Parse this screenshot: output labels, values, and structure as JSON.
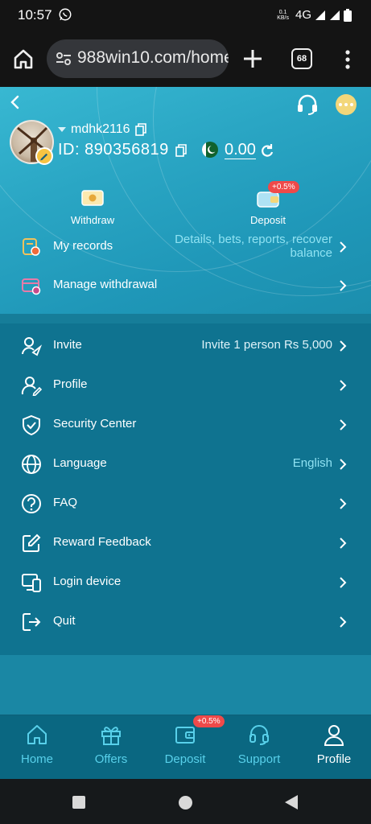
{
  "status_bar": {
    "time": "10:57",
    "speed_value": "0.1",
    "speed_unit": "KB/s",
    "network": "4G",
    "icons": [
      "whatsapp-icon",
      "signal-icon",
      "battery-icon"
    ]
  },
  "browser": {
    "url": "988win10.com/home",
    "tab_count": "68"
  },
  "header": {
    "username": "mdhk2116",
    "id_label": "ID: 890356819",
    "balance": "0.00"
  },
  "quick_actions": {
    "withdraw_label": "Withdraw",
    "deposit_label": "Deposit",
    "deposit_badge": "+0.5%"
  },
  "records": [
    {
      "label": "My records",
      "value_line1": "Details, bets, reports, recover",
      "value_line2": "balance"
    },
    {
      "label": "Manage withdrawal",
      "value_line1": "",
      "value_line2": ""
    }
  ],
  "menu": [
    {
      "label": "Invite",
      "value": "Invite 1 person Rs 5,000",
      "icon": "invite-icon"
    },
    {
      "label": "Profile",
      "value": "",
      "icon": "profile-icon"
    },
    {
      "label": "Security Center",
      "value": "",
      "icon": "shield-icon"
    },
    {
      "label": "Language",
      "value": "English",
      "icon": "globe-icon"
    },
    {
      "label": "FAQ",
      "value": "",
      "icon": "question-icon"
    },
    {
      "label": "Reward Feedback",
      "value": "",
      "icon": "edit-icon"
    },
    {
      "label": "Login device",
      "value": "",
      "icon": "devices-icon"
    },
    {
      "label": "Quit",
      "value": "",
      "icon": "logout-icon"
    }
  ],
  "bottom_nav": [
    {
      "label": "Home",
      "icon": "home-icon"
    },
    {
      "label": "Offers",
      "icon": "gift-icon"
    },
    {
      "label": "Deposit",
      "icon": "wallet-icon",
      "badge": "+0.5%"
    },
    {
      "label": "Support",
      "icon": "headset-icon"
    },
    {
      "label": "Profile",
      "icon": "user-icon",
      "active": true
    }
  ],
  "colors": {
    "header_top": "#38b8d2",
    "list_bg": "#0f7390",
    "nav_bg": "#0a6781",
    "nav_label": "#58d0ea",
    "badge": "#ef4a4a",
    "accent_gold": "#f3d77a"
  }
}
